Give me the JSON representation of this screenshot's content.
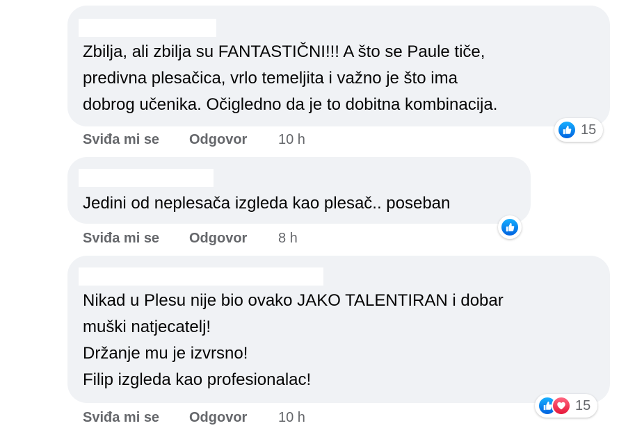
{
  "comments": [
    {
      "text": "Zbilja, ali zbilja su FANTASTIČNI!!! A što se Paule tiče,\npredivna plesačica, vrlo temeljita i važno je što ima\ndobrog učenika. Očigledno da je to dobitna kombinacija.",
      "like_label": "Sviđa mi se",
      "reply_label": "Odgovor",
      "time": "10 h",
      "reactions": [
        "like-icon"
      ],
      "reaction_count": "15"
    },
    {
      "text": "Jedini od neplesača izgleda kao plesač.. poseban",
      "like_label": "Sviđa mi se",
      "reply_label": "Odgovor",
      "time": "8 h",
      "reactions": [
        "like-icon"
      ],
      "reaction_count": ""
    },
    {
      "text": "Nikad u Plesu nije bio ovako JAKO TALENTIRAN i dobar\nmuški natjecatelj!\nDržanje mu je izvrsno!\nFilip izgleda kao profesionalac!",
      "like_label": "Sviđa mi se",
      "reply_label": "Odgovor",
      "time": "10 h",
      "reactions": [
        "like-icon",
        "love-icon"
      ],
      "reaction_count": "15"
    }
  ],
  "colors": {
    "bubble": "#f0f2f5",
    "text": "#050505",
    "secondary": "#65676b",
    "like": "#0866ff",
    "love": "#f33e58"
  }
}
